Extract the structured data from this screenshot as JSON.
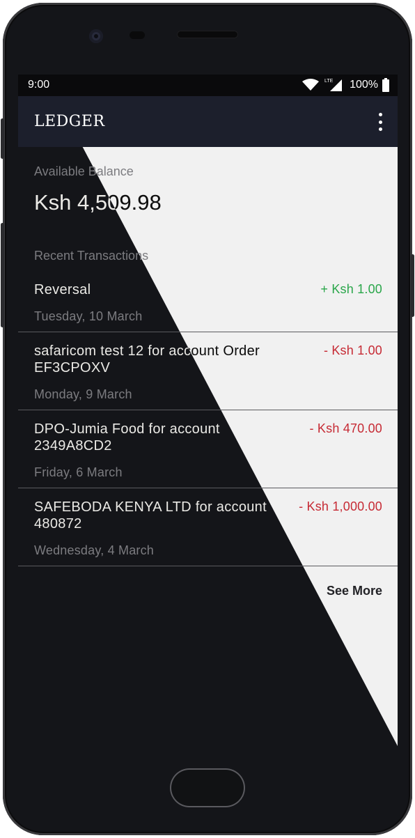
{
  "status_bar": {
    "time": "9:00",
    "network": "LTE",
    "battery": "100%",
    "icons": [
      "wifi-icon",
      "signal-icon",
      "battery-icon"
    ]
  },
  "app_bar": {
    "title": "LEDGER",
    "menu_icon": "more-vert-icon"
  },
  "balance": {
    "label": "Available Balance",
    "value": "Ksh 4,509.98"
  },
  "transactions": {
    "label": "Recent Transactions",
    "items": [
      {
        "title": "Reversal",
        "date": "Tuesday, 10 March",
        "amount": "+ Ksh 1.00",
        "type": "credit"
      },
      {
        "title": "safaricom test 12  for account Order EF3CPOXV",
        "date": "Monday, 9 March",
        "amount": "- Ksh 1.00",
        "type": "debit"
      },
      {
        "title": "DPO-Jumia Food  for account 2349A8CD2",
        "date": "Friday, 6 March",
        "amount": "- Ksh 470.00",
        "type": "debit"
      },
      {
        "title": "SAFEBODA KENYA LTD  for account 480872",
        "date": "Wednesday, 4 March",
        "amount": "- Ksh 1,000.00",
        "type": "debit"
      }
    ],
    "see_more": "See More"
  },
  "colors": {
    "app_bar": "#1c1f2c",
    "screen_bg": "#f1f1f1",
    "overlay": "#141519",
    "credit": "#2aa64a",
    "debit": "#c62a34"
  }
}
